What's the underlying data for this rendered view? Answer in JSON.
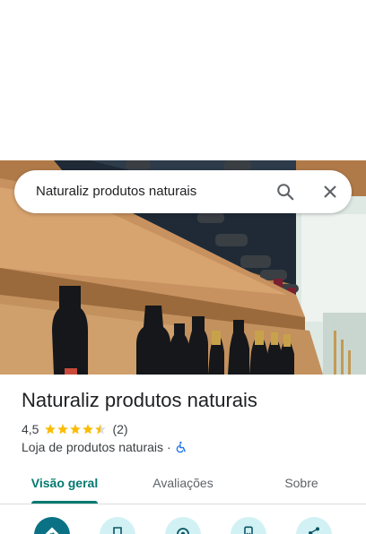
{
  "search": {
    "query": "Naturaliz produtos naturais"
  },
  "place": {
    "name": "Naturaliz produtos naturais",
    "rating": "4,5",
    "reviews": "(2)",
    "category": "Loja de produtos naturais",
    "separator": "·"
  },
  "tabs": [
    {
      "label": "Visão geral"
    },
    {
      "label": "Avaliações"
    },
    {
      "label": "Sobre"
    }
  ],
  "colors": {
    "accent": "#01796f",
    "star": "#fbbc04",
    "action_bg": "#d2f1f4",
    "action_primary": "#0b7285"
  },
  "icons": {
    "search": "search-icon",
    "close": "close-icon",
    "accessible": "wheelchair-icon",
    "actions": [
      "directions-icon",
      "save-icon",
      "nearby-icon",
      "send-to-phone-icon",
      "share-icon"
    ]
  }
}
